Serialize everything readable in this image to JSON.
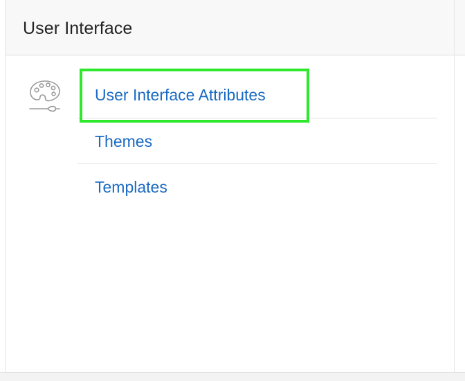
{
  "panel": {
    "title": "User Interface",
    "icon": "palette-icon"
  },
  "links": [
    {
      "label": "User Interface Attributes",
      "highlighted": true
    },
    {
      "label": "Themes",
      "highlighted": false
    },
    {
      "label": "Templates",
      "highlighted": false
    }
  ],
  "colors": {
    "link": "#1a6ac2",
    "title": "#222222",
    "header_bg": "#f8f8f8",
    "highlight": "#2ee82e",
    "icon": "#9a9a9a"
  }
}
